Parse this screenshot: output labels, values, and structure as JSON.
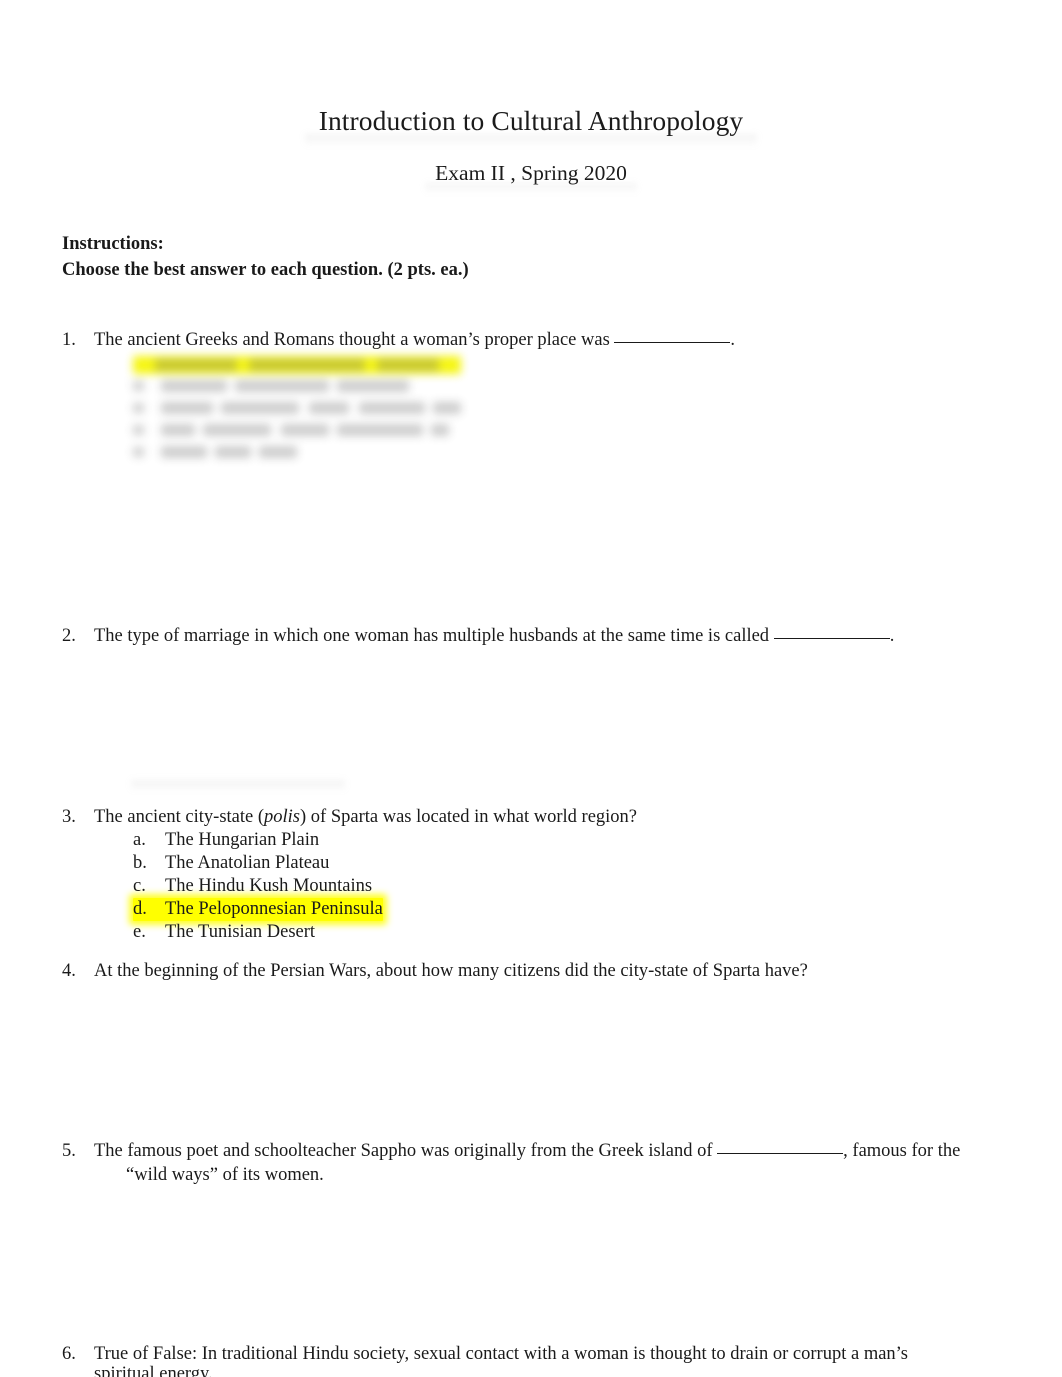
{
  "document": {
    "title": "Introduction to Cultural Anthropology",
    "subtitle": "Exam II , Spring 2020"
  },
  "instructions": {
    "heading": "Instructions:",
    "body": "Choose the best answer to each question. (2 pts. ea.)"
  },
  "questions": [
    {
      "number": "1.",
      "text_before": "The ancient Greeks and Romans thought a woman’s proper place was ",
      "text_after": ".",
      "blank": true,
      "options_blurred": true,
      "options_count": 5,
      "highlighted_option_index": 0
    },
    {
      "number": "2.",
      "text_before": "The type of marriage in which one woman has multiple husbands at the same time is called ",
      "text_after": ".",
      "blank": true
    },
    {
      "number": "3.",
      "text_before": "The ancient city-state (",
      "italic_word": "polis",
      "text_after": ") of Sparta was located in what world region?",
      "options": [
        {
          "letter": "a.",
          "label": "The Hungarian Plain",
          "highlighted": false
        },
        {
          "letter": "b.",
          "label": "The Anatolian Plateau",
          "highlighted": false
        },
        {
          "letter": "c.",
          "label": "The Hindu Kush Mountains",
          "highlighted": false
        },
        {
          "letter": "d.",
          "label": "The Peloponnesian Peninsula",
          "highlighted": true
        },
        {
          "letter": "e.",
          "label": "The Tunisian Desert",
          "highlighted": false
        }
      ]
    },
    {
      "number": "4.",
      "text": "At the beginning of the Persian Wars, about how many citizens did the city-state of Sparta have?"
    },
    {
      "number": "5.",
      "text_before": "The famous poet and schoolteacher Sappho was originally from the Greek island of ",
      "text_after": ", famous for the",
      "continuation": "“wild ways” of its women.",
      "blank": true
    },
    {
      "number": "6.",
      "text": "True of False: In traditional Hindu society, sexual contact with a woman is thought to drain or corrupt a man’s",
      "continuation_clipped": "spiritual energy."
    }
  ],
  "colors": {
    "highlight": "#FFFF00",
    "text": "#1A1A1A",
    "page": "#FFFFFF"
  }
}
